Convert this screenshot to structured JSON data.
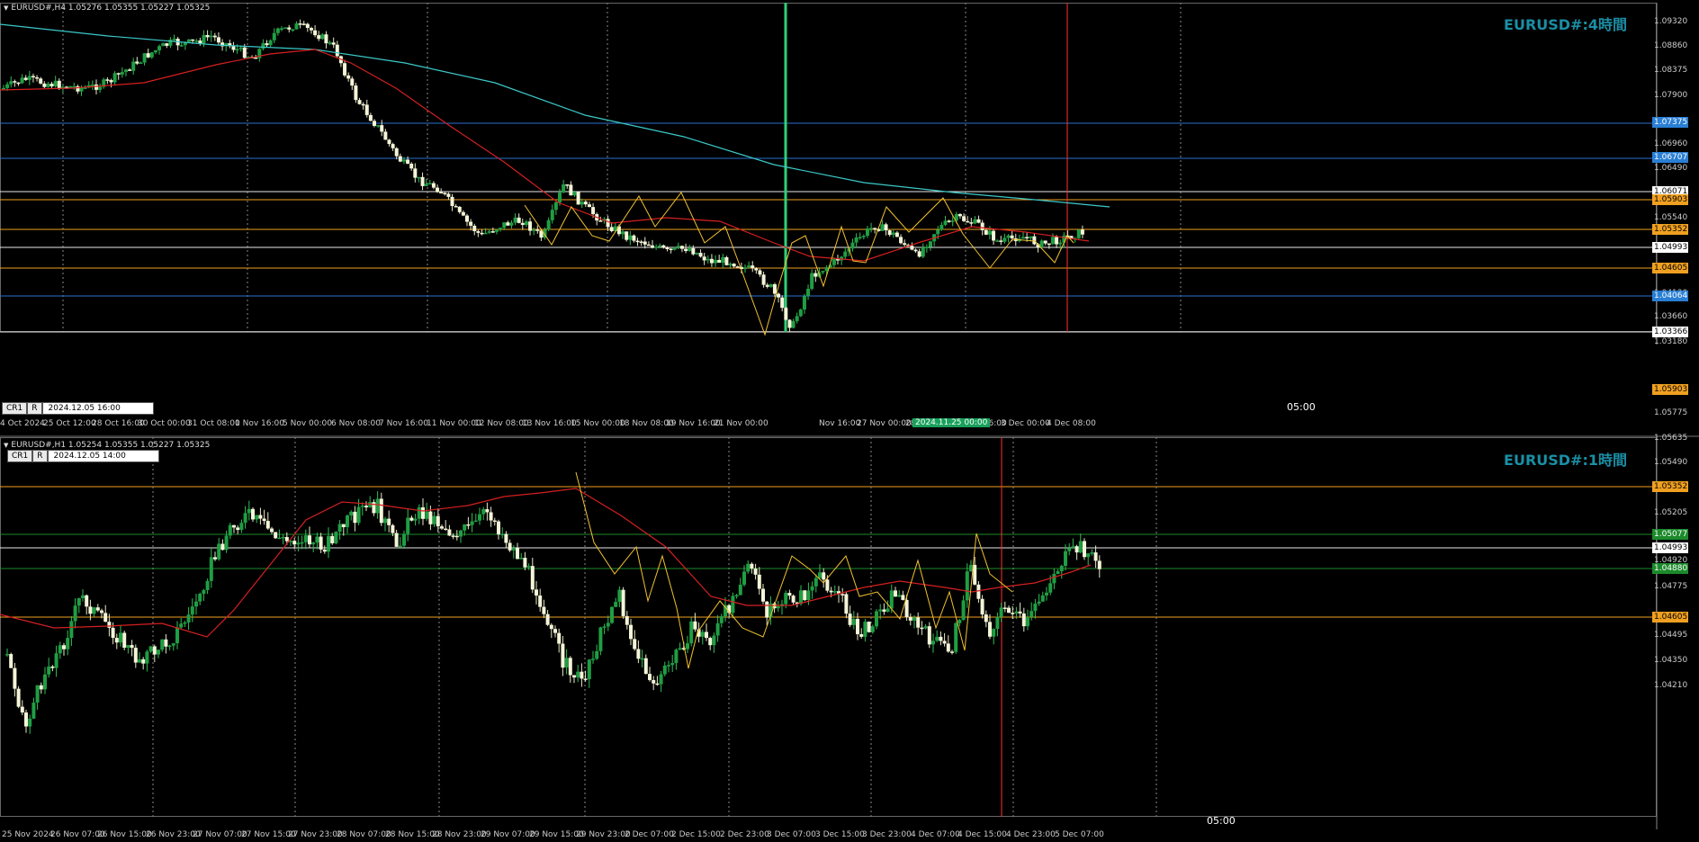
{
  "pane1": {
    "header": "EURUSD#,H4  1.05276 1.05355 1.05227 1.05325",
    "title": "EURUSD#:4時間",
    "cr_label": "CR1",
    "r_label": "R",
    "cursor_date": "2024.12.05 16:00",
    "price_labels": [
      "1.09320",
      "1.08860",
      "1.08375",
      "1.07900",
      "1.06960",
      "1.06490",
      "1.05540",
      "1.04130",
      "1.03660",
      "1.03180"
    ],
    "price_tags": [
      {
        "text": "1.07375",
        "color": "#2a7fd4"
      },
      {
        "text": "1.06707",
        "color": "#2a7fd4"
      },
      {
        "text": "1.06071",
        "color": "#ffffff"
      },
      {
        "text": "1.05903",
        "color": "#f0a020"
      },
      {
        "text": "1.05352",
        "color": "#f0a020"
      },
      {
        "text": "1.04993",
        "color": "#ffffff"
      },
      {
        "text": "1.04605",
        "color": "#f0a020"
      },
      {
        "text": "1.04064",
        "color": "#2a7fd4"
      },
      {
        "text": "1.03366",
        "color": "#ffffff"
      }
    ],
    "time_labels": [
      "4 Oct 2024",
      "25 Oct 12:00",
      "28 Oct 16:00",
      "30 Oct 00:00",
      "31 Oct 08:00",
      "1 Nov 16:00",
      "5 Nov 00:00",
      "6 Nov 08:00",
      "7 Nov 16:00",
      "11 Nov 00:00",
      "12 Nov 08:00",
      "13 Nov 16:00",
      "15 Nov 00:00",
      "18 Nov 08:00",
      "19 Nov 16:00",
      "21 Nov 00:00",
      "Nov 16:00",
      "27 Nov 00:00",
      "28 Nov 08:00",
      "29 Nov 16:00",
      "3 Dec 00:00",
      "4 Dec 08:00"
    ],
    "time_tag": "2024.11.25 00:00",
    "marker_time": "05:00"
  },
  "pane2": {
    "header": "EURUSD#,H1  1.05254 1.05355 1.05227 1.05325",
    "title": "EURUSD#:1時間",
    "cr_label": "CR1",
    "r_label": "R",
    "cursor_date": "2024.12.05 14:00",
    "price_labels": [
      "1.05775",
      "1.05635",
      "1.05490",
      "1.05205",
      "1.04920",
      "1.04775",
      "1.04495",
      "1.04350",
      "1.04210"
    ],
    "price_tags": [
      {
        "text": "1.05903",
        "color": "#f0a020"
      },
      {
        "text": "1.05352",
        "color": "#f0a020"
      },
      {
        "text": "1.05077",
        "color": "#1c8a2c"
      },
      {
        "text": "1.04993",
        "color": "#ffffff"
      },
      {
        "text": "1.04880",
        "color": "#1c8a2c"
      },
      {
        "text": "1.04605",
        "color": "#f0a020"
      }
    ],
    "time_labels": [
      "25 Nov 2024",
      "26 Nov 07:00",
      "26 Nov 15:00",
      "26 Nov 23:00",
      "27 Nov 07:00",
      "27 Nov 15:00",
      "27 Nov 23:00",
      "28 Nov 07:00",
      "28 Nov 15:00",
      "28 Nov 23:00",
      "29 Nov 07:00",
      "29 Nov 15:00",
      "29 Nov 23:00",
      "2 Dec 07:00",
      "2 Dec 15:00",
      "2 Dec 23:00",
      "3 Dec 07:00",
      "3 Dec 15:00",
      "3 Dec 23:00",
      "4 Dec 07:00",
      "4 Dec 15:00",
      "4 Dec 23:00",
      "5 Dec 07:00"
    ],
    "marker_time": "05:00"
  }
}
